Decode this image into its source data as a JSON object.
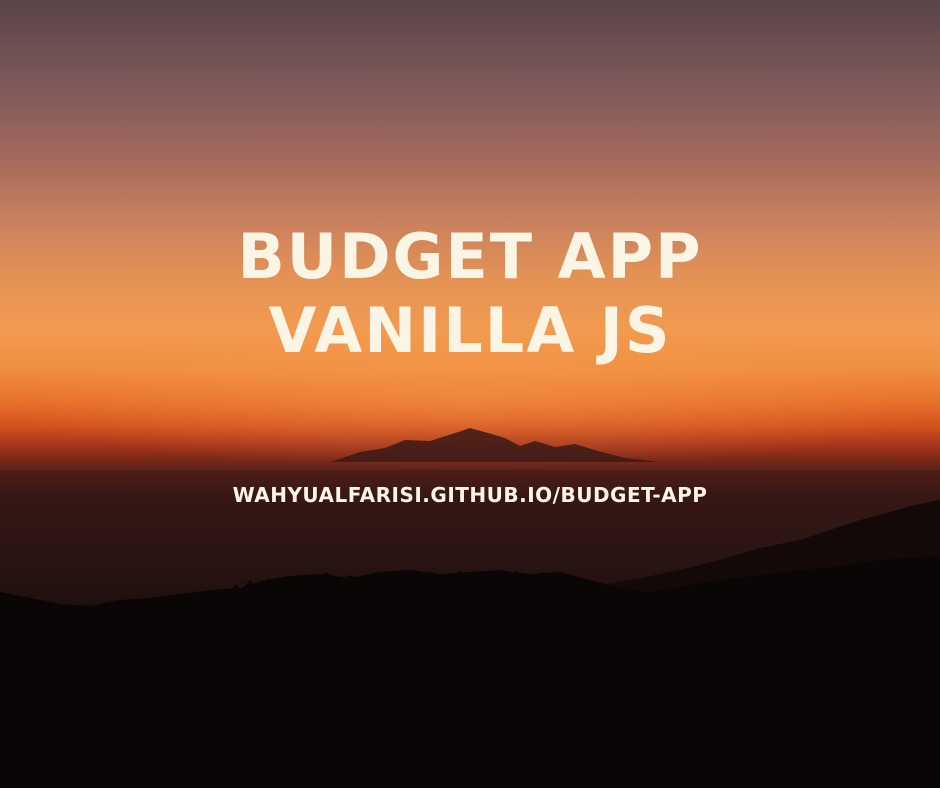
{
  "poster": {
    "title_line_1": "BUDGET APP",
    "title_line_2": "VANILLA JS",
    "url": "WAHYUALFARISI.GITHUB.IO/BUDGET-APP"
  },
  "colors": {
    "text": "#fbf5e6",
    "sky_top": "#5a4448",
    "sky_horizon": "#f29a4f",
    "horizon_glow": "#d4531d",
    "silhouette": "#0b0606"
  }
}
